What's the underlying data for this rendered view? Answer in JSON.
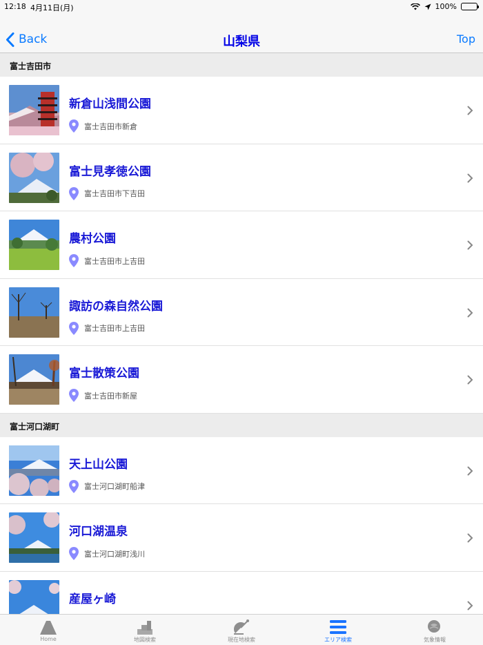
{
  "status_bar": {
    "time": "12:18",
    "date": "4月11日(月)",
    "battery": "100%"
  },
  "nav": {
    "back_label": "Back",
    "title": "山梨県",
    "top_label": "Top"
  },
  "sections": [
    {
      "header": "富士吉田市",
      "items": [
        {
          "title": "新倉山浅間公園",
          "address": "富士吉田市新倉"
        },
        {
          "title": "富士見孝徳公園",
          "address": "富士吉田市下吉田"
        },
        {
          "title": "農村公園",
          "address": "富士吉田市上吉田"
        },
        {
          "title": "諏訪の森自然公園",
          "address": "富士吉田市上吉田"
        },
        {
          "title": "富士散策公園",
          "address": "富士吉田市新屋"
        }
      ]
    },
    {
      "header": "富士河口湖町",
      "items": [
        {
          "title": "天上山公園",
          "address": "富士河口湖町船津"
        },
        {
          "title": "河口湖温泉",
          "address": "富士河口湖町浅川"
        },
        {
          "title": "産屋ヶ崎",
          "address": ""
        }
      ]
    }
  ],
  "tabs": [
    {
      "label": "Home",
      "icon": "mountain-icon"
    },
    {
      "label": "地図検索",
      "icon": "map-search-icon"
    },
    {
      "label": "現在地検索",
      "icon": "location-search-icon"
    },
    {
      "label": "エリア検索",
      "icon": "area-list-icon"
    },
    {
      "label": "気象情報",
      "icon": "weather-icon"
    }
  ],
  "colors": {
    "accent": "#0a7aff",
    "title_blue": "#0000e6",
    "item_blue": "#1a1ad6",
    "pin": "#8a8aff",
    "active_tab": "#1a73ff"
  }
}
